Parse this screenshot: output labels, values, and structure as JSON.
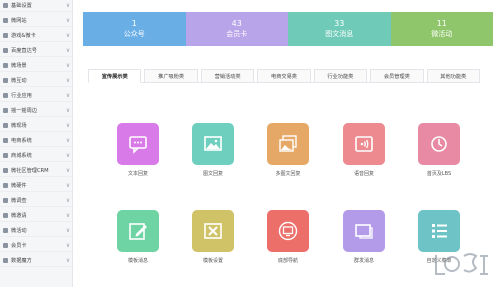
{
  "sidebar": {
    "items": [
      {
        "label": "基础设置",
        "icon": "settings-icon",
        "chev": "∨"
      },
      {
        "label": "微网站",
        "icon": "site-icon",
        "chev": "∨"
      },
      {
        "label": "游戏&微卡",
        "icon": "game-icon",
        "chev": "∨"
      },
      {
        "label": "百度直达号",
        "icon": "baidu-icon",
        "chev": "∨"
      },
      {
        "label": "微场景",
        "icon": "scene-icon",
        "chev": "∨"
      },
      {
        "label": "微互动",
        "icon": "interact-icon",
        "chev": "∨"
      },
      {
        "label": "行业应用",
        "icon": "industry-icon",
        "chev": "∨"
      },
      {
        "label": "摇一摇周边",
        "icon": "shake-icon",
        "chev": "∨"
      },
      {
        "label": "微现场",
        "icon": "live-icon",
        "chev": "∨"
      },
      {
        "label": "电商系统",
        "icon": "shop-icon",
        "chev": "∨"
      },
      {
        "label": "商城系统",
        "icon": "mall-icon",
        "chev": "∨"
      },
      {
        "label": "微社区管理CRM",
        "icon": "crm-icon",
        "chev": "∨"
      },
      {
        "label": "微硬件",
        "icon": "hardware-icon",
        "chev": "∨"
      },
      {
        "label": "微调查",
        "icon": "survey-icon",
        "chev": "∨"
      },
      {
        "label": "微邀请",
        "icon": "invite-icon",
        "chev": "∨"
      },
      {
        "label": "微活动",
        "icon": "activity-icon",
        "chev": "∨"
      },
      {
        "label": "会员卡",
        "icon": "card-icon",
        "chev": "∨"
      },
      {
        "label": "数据魔方",
        "icon": "data-icon",
        "chev": "∨"
      }
    ]
  },
  "stats": [
    {
      "num": "1",
      "label": "公众号",
      "color": "#6aaee6"
    },
    {
      "num": "43",
      "label": "会员卡",
      "color": "#b7a4e9"
    },
    {
      "num": "33",
      "label": "图文消息",
      "color": "#6fcbb8"
    },
    {
      "num": "11",
      "label": "微活动",
      "color": "#8fc66c"
    }
  ],
  "tabs": [
    "宣传展示类",
    "推广吸粉类",
    "营销活动类",
    "电商交易类",
    "行业功能类",
    "会员管理类",
    "其他功能类"
  ],
  "tiles": [
    {
      "label": "文本回复",
      "color": "#d87ae8",
      "icon": "chat-icon"
    },
    {
      "label": "图文回复",
      "color": "#6fcfbe",
      "icon": "image-icon"
    },
    {
      "label": "多图文回复",
      "color": "#e6a866",
      "icon": "multi-image-icon"
    },
    {
      "label": "语音回复",
      "color": "#ec8a90",
      "icon": "voice-icon"
    },
    {
      "label": "首页及LBS",
      "color": "#e88aa3",
      "icon": "clock-location-icon"
    },
    {
      "label": "模板消息",
      "color": "#6ed4a4",
      "icon": "edit-icon"
    },
    {
      "label": "模板设置",
      "color": "#d0c266",
      "icon": "tools-icon"
    },
    {
      "label": "底部导航",
      "color": "#ec6f6a",
      "icon": "monitor-icon"
    },
    {
      "label": "群发消息",
      "color": "#b49bea",
      "icon": "message-icon"
    },
    {
      "label": "自定义菜单",
      "color": "#6ec3c7",
      "icon": "menu-icon"
    }
  ],
  "watermark": {
    "icon": "baidu-jingyan-logo-icon"
  }
}
